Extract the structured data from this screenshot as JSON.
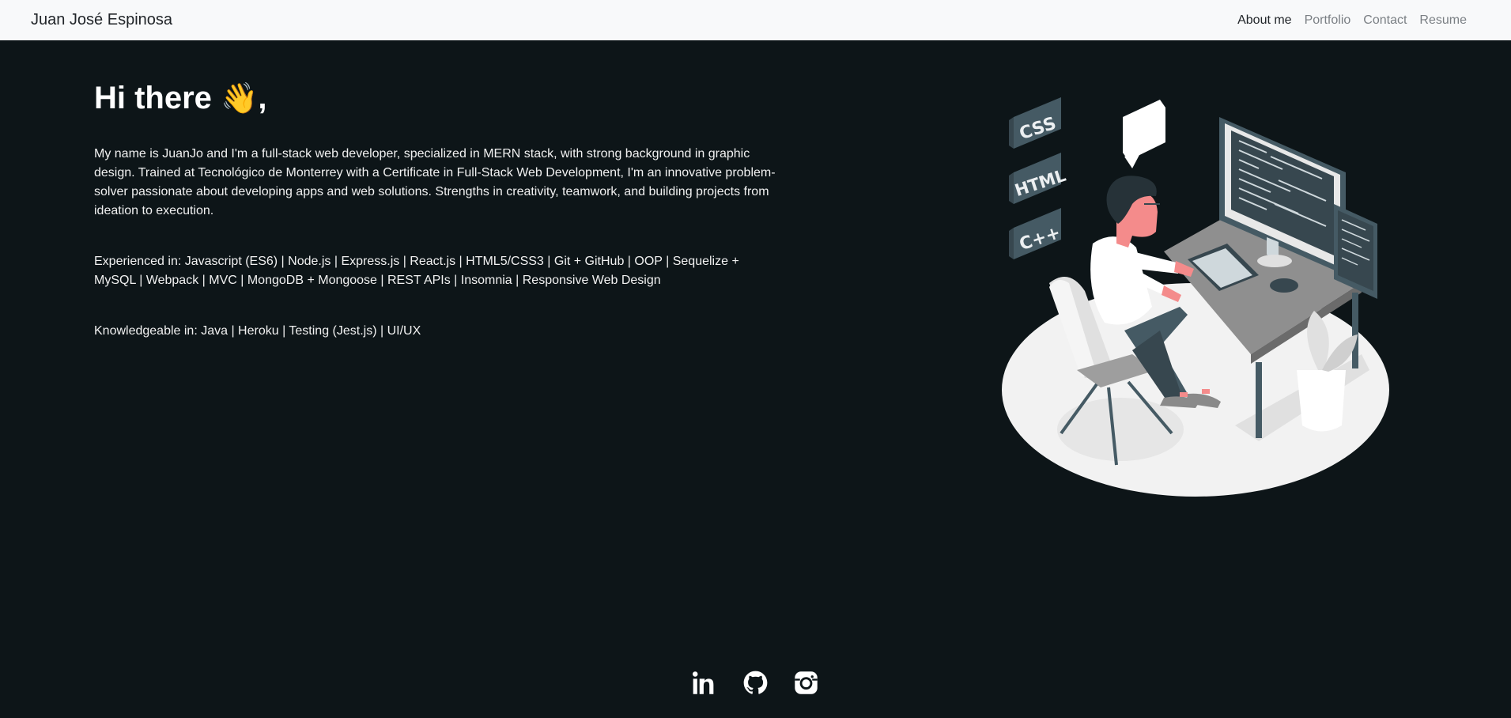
{
  "navbar": {
    "brand": "Juan José Espinosa",
    "links": [
      {
        "label": "About me",
        "active": true
      },
      {
        "label": "Portfolio",
        "active": false
      },
      {
        "label": "Contact",
        "active": false
      },
      {
        "label": "Resume",
        "active": false
      }
    ]
  },
  "intro": {
    "greeting": "Hi there",
    "greeting_emoji": "👋",
    "greeting_suffix": ",",
    "paragraphs": [
      "My name is JuanJo and I'm a full-stack web developer, specialized in MERN stack, with strong background in graphic design. Trained at Tecnológico de Monterrey with a Certificate in Full-Stack Web Development, I'm an innovative problem-solver passionate about developing apps and web solutions. Strengths in creativity, teamwork, and building projects from ideation to execution.",
      "Experienced in: Javascript (ES6) | Node.js | Express.js | React.js | HTML5/CSS3 | Git + GitHub | OOP | Sequelize + MySQL | Webpack | MVC | MongoDB + Mongoose | REST APIs | Insomnia | Responsive Web Design",
      "Knowledgeable in: Java | Heroku | Testing (Jest.js) | UI/UX"
    ]
  },
  "illustration": {
    "labels": [
      "CSS",
      "HTML",
      "C++"
    ]
  },
  "footer": {
    "icons": [
      "linkedin-icon",
      "github-icon",
      "instagram-icon"
    ]
  }
}
